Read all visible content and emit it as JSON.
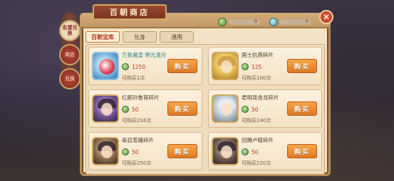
{
  "title": "百朝商店",
  "close_label": "✕",
  "side_tabs": [
    {
      "label": "名望兑换",
      "active": true
    },
    {
      "label": "商店",
      "active": false
    },
    {
      "label": "兑换",
      "active": false
    }
  ],
  "currencies": [
    {
      "icon": "jade-coin-icon",
      "value": "0"
    },
    {
      "icon": "blue-coin-icon",
      "value": "0"
    }
  ],
  "sub_tabs": [
    {
      "label": "百朝宝库",
      "active": true
    },
    {
      "label": "化身",
      "active": false
    },
    {
      "label": "通用",
      "active": false
    }
  ],
  "items": [
    {
      "name": "万象魔皇·寒光漫月",
      "price": "1250",
      "limit": "可购买1次",
      "style": "blue",
      "teal": true
    },
    {
      "name": "国士抗燕碎片",
      "price": "125",
      "limit": "可购买100次",
      "style": "gold",
      "teal": false
    },
    {
      "name": "红颜孙鲁育碎片",
      "price": "50",
      "limit": "可购买216次",
      "style": "purple",
      "teal": false
    },
    {
      "name": "君明尧舍龙碎片",
      "price": "50",
      "limit": "可购买240次",
      "style": "silver",
      "teal": false
    },
    {
      "name": "奇启蒸娥碎片",
      "price": "50",
      "limit": "可购买250次",
      "style": "brown",
      "teal": false
    },
    {
      "name": "回赐卢植碎片",
      "price": "50",
      "limit": "可购买220次",
      "style": "dark",
      "teal": false
    }
  ],
  "buy_label": "购买"
}
